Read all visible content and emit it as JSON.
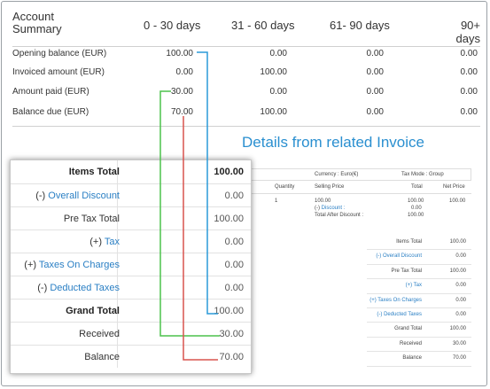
{
  "summary": {
    "title_line1": "Account",
    "title_line2": "Summary",
    "columns": [
      "0 - 30 days",
      "31 - 60 days",
      "61- 90 days",
      "90+ days"
    ],
    "rows": [
      {
        "label": "Opening balance (EUR)",
        "values": [
          "100.00",
          "0.00",
          "0.00",
          "0.00"
        ]
      },
      {
        "label": "Invoiced amount (EUR)",
        "values": [
          "0.00",
          "100.00",
          "0.00",
          "0.00"
        ]
      },
      {
        "label": "Amount paid (EUR)",
        "values": [
          "30.00",
          "0.00",
          "0.00",
          "0.00"
        ]
      },
      {
        "label": "Balance due (EUR)",
        "values": [
          "70.00",
          "100.00",
          "0.00",
          "0.00"
        ]
      }
    ]
  },
  "details_title": "Details from related Invoice",
  "background_invoice": {
    "currency": "Currency : Euro(€)",
    "tax_mode": "Tax Mode : Group",
    "col_quantity": "Quantity",
    "col_selling_price": "Selling Price",
    "col_total": "Total",
    "col_net_price": "Net Price",
    "quantity": "1",
    "price": "100.00",
    "discount_prefix": "(-)",
    "discount_label": "Discount :",
    "total_after_discount": "Total After Discount :",
    "total_values": [
      "100.00",
      "0.00",
      "100.00"
    ],
    "net_price": "100.00",
    "totals": [
      {
        "label": "Items Total",
        "value": "100.00"
      },
      {
        "label": "(-) Overall Discount",
        "value": "0.00"
      },
      {
        "label": "Pre Tax Total",
        "value": "100.00"
      },
      {
        "label": "(+) Tax",
        "value": "0.00"
      },
      {
        "label": "(+) Taxes On Charges",
        "value": "0.00"
      },
      {
        "label": "(-) Deducted Taxes",
        "value": "0.00"
      },
      {
        "label": "Grand Total",
        "value": "100.00"
      },
      {
        "label": "Received",
        "value": "30.00"
      },
      {
        "label": "Balance",
        "value": "70.00"
      }
    ]
  },
  "panel": {
    "items_total": {
      "label": "Items Total",
      "value": "100.00"
    },
    "overall_discount": {
      "prefix": "(-)",
      "label": "Overall Discount",
      "value": "0.00"
    },
    "pre_tax_total": {
      "label": "Pre Tax Total",
      "value": "100.00"
    },
    "tax": {
      "prefix": "(+)",
      "label": "Tax",
      "value": "0.00"
    },
    "taxes_on_charges": {
      "prefix": "(+)",
      "label": "Taxes On Charges",
      "value": "0.00"
    },
    "deducted_taxes": {
      "prefix": "(-)",
      "label": "Deducted Taxes",
      "value": "0.00"
    },
    "grand_total": {
      "label": "Grand Total",
      "value": "100.00"
    },
    "received": {
      "label": "Received",
      "value": "30.00"
    },
    "balance": {
      "label": "Balance",
      "value": "70.00"
    }
  },
  "colors": {
    "link_blue": "#2a7fc4",
    "title_blue": "#2a8fd0",
    "connector_blue": "#2a9ad8",
    "connector_green": "#4cc24c",
    "connector_red": "#d9534f"
  }
}
